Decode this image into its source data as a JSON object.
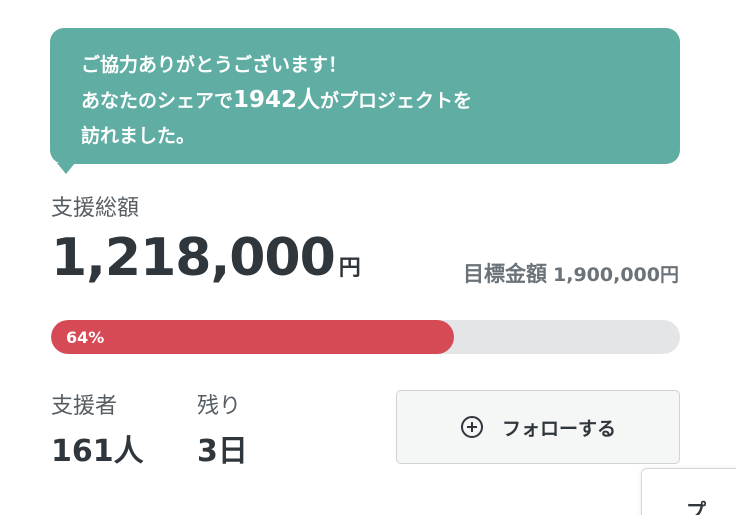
{
  "bubble": {
    "line1": "ご協力ありがとうございます！",
    "line2_pre": "あなたのシェアで",
    "line2_count": "1942人",
    "line2_post": "がプロジェクトを",
    "line3": "訪れました。"
  },
  "funding": {
    "total_label": "支援総額",
    "total_amount": "1,218,000",
    "currency_unit": "円",
    "goal_label": "目標金額",
    "goal_amount": "1,900,000円",
    "progress_text": "64%",
    "progress_fraction": 0.64
  },
  "stats": {
    "supporters_label": "支援者",
    "supporters_value": "161人",
    "remaining_label": "残り",
    "remaining_value": "3日"
  },
  "follow_button": {
    "label": "フォローする",
    "icon": "plus-circle-icon"
  },
  "corner_card": {
    "label": "プ"
  },
  "colors": {
    "bubble_bg": "#5fada3",
    "progress_fill": "#d64a56",
    "progress_track": "#e3e5e7",
    "text_dark": "#2f363c"
  }
}
